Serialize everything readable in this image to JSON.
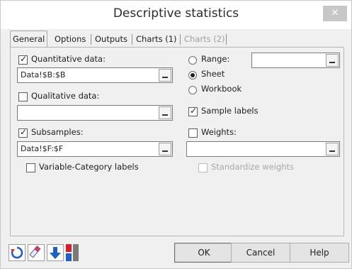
{
  "window": {
    "title": "Descriptive statistics",
    "close_glyph": "✕"
  },
  "tabs": [
    {
      "label": "General",
      "active": true,
      "enabled": true
    },
    {
      "label": "Options",
      "active": false,
      "enabled": true
    },
    {
      "label": "Outputs",
      "active": false,
      "enabled": true
    },
    {
      "label": "Charts (1)",
      "active": false,
      "enabled": true
    },
    {
      "label": "Charts (2)",
      "active": false,
      "enabled": false
    }
  ],
  "general": {
    "quantitative": {
      "label": "Quantitative data:",
      "checked": true,
      "value": "Data!$B:$B"
    },
    "qualitative": {
      "label": "Qualitative data:",
      "checked": false,
      "value": ""
    },
    "subsamples": {
      "label": "Subsamples:",
      "checked": true,
      "value": "Data!$F:$F"
    },
    "variable_category": {
      "label": "Variable-Category labels",
      "checked": false
    },
    "range": {
      "label": "Range:",
      "selected": false,
      "value": ""
    },
    "sheet": {
      "label": "Sheet",
      "selected": true
    },
    "workbook": {
      "label": "Workbook",
      "selected": false
    },
    "sample_labels": {
      "label": "Sample labels",
      "checked": true
    },
    "weights": {
      "label": "Weights:",
      "checked": false,
      "value": ""
    },
    "standardize": {
      "label": "Standardize weights",
      "checked": false,
      "enabled": false
    }
  },
  "checkmark_glyph": "✓",
  "footer": {
    "ok": "OK",
    "cancel": "Cancel",
    "help": "Help",
    "tools": [
      {
        "icon": "reset-icon",
        "color": "#1f5fbf"
      },
      {
        "icon": "eraser-icon",
        "color": "#d23a5a"
      },
      {
        "icon": "arrow-down-icon",
        "color": "#1f5fbf"
      },
      {
        "icon": "xlstat-grid-icon",
        "color": "#d41f2a"
      }
    ]
  }
}
